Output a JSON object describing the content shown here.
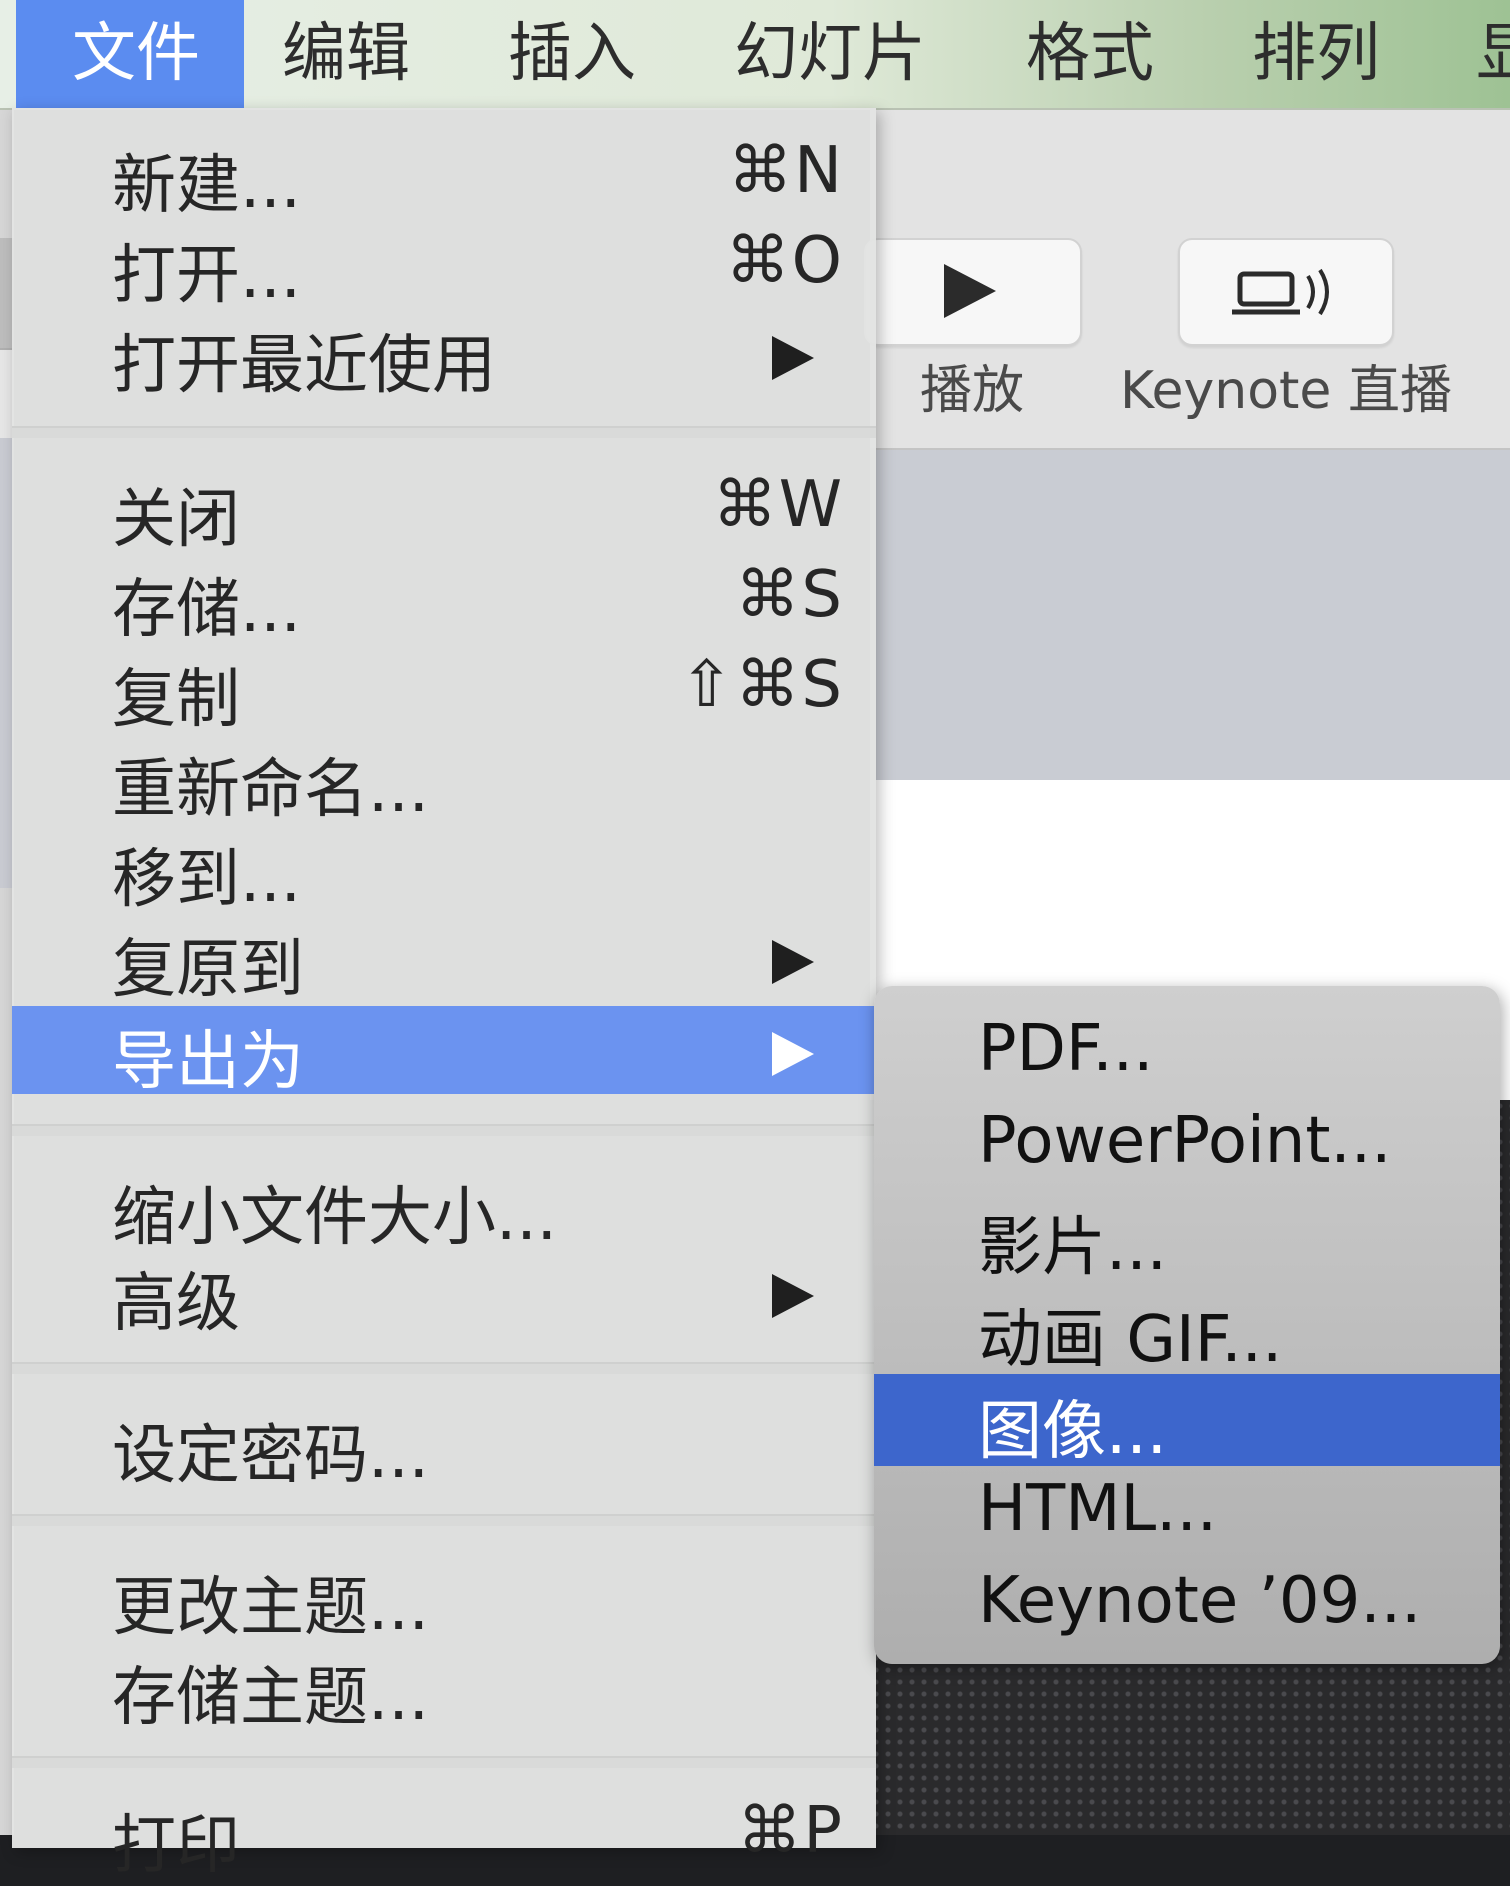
{
  "menubar": {
    "items": [
      "文件",
      "编辑",
      "插入",
      "幻灯片",
      "格式",
      "排列",
      "显"
    ]
  },
  "toolbar": {
    "play_label": "播放",
    "live_label": "Keynote 直播"
  },
  "file_menu": {
    "items": [
      {
        "label": "新建...",
        "shortcut": "⌘N"
      },
      {
        "label": "打开...",
        "shortcut": "⌘O"
      },
      {
        "label": "打开最近使用",
        "submenu": true
      },
      {
        "label": "关闭",
        "shortcut": "⌘W"
      },
      {
        "label": "存储...",
        "shortcut": "⌘S"
      },
      {
        "label": "复制",
        "shortcut": "⇧⌘S"
      },
      {
        "label": "重新命名..."
      },
      {
        "label": "移到..."
      },
      {
        "label": "复原到",
        "submenu": true
      },
      {
        "label": "导出为",
        "submenu": true,
        "highlighted": true
      },
      {
        "label": "缩小文件大小..."
      },
      {
        "label": "高级",
        "submenu": true
      },
      {
        "label": "设定密码..."
      },
      {
        "label": "更改主题..."
      },
      {
        "label": "存储主题..."
      },
      {
        "label": "打印",
        "shortcut": "⌘P"
      }
    ]
  },
  "export_submenu": {
    "items": [
      {
        "label": "PDF..."
      },
      {
        "label": "PowerPoint..."
      },
      {
        "label": "影片..."
      },
      {
        "label": "动画 GIF..."
      },
      {
        "label": "图像...",
        "highlighted": true
      },
      {
        "label": "HTML..."
      },
      {
        "label": "Keynote ’09..."
      }
    ]
  },
  "colors": {
    "menu_highlight": "#6b93f0",
    "submenu_highlight": "#3d66cc",
    "menubar_active": "#5b8cf0"
  }
}
